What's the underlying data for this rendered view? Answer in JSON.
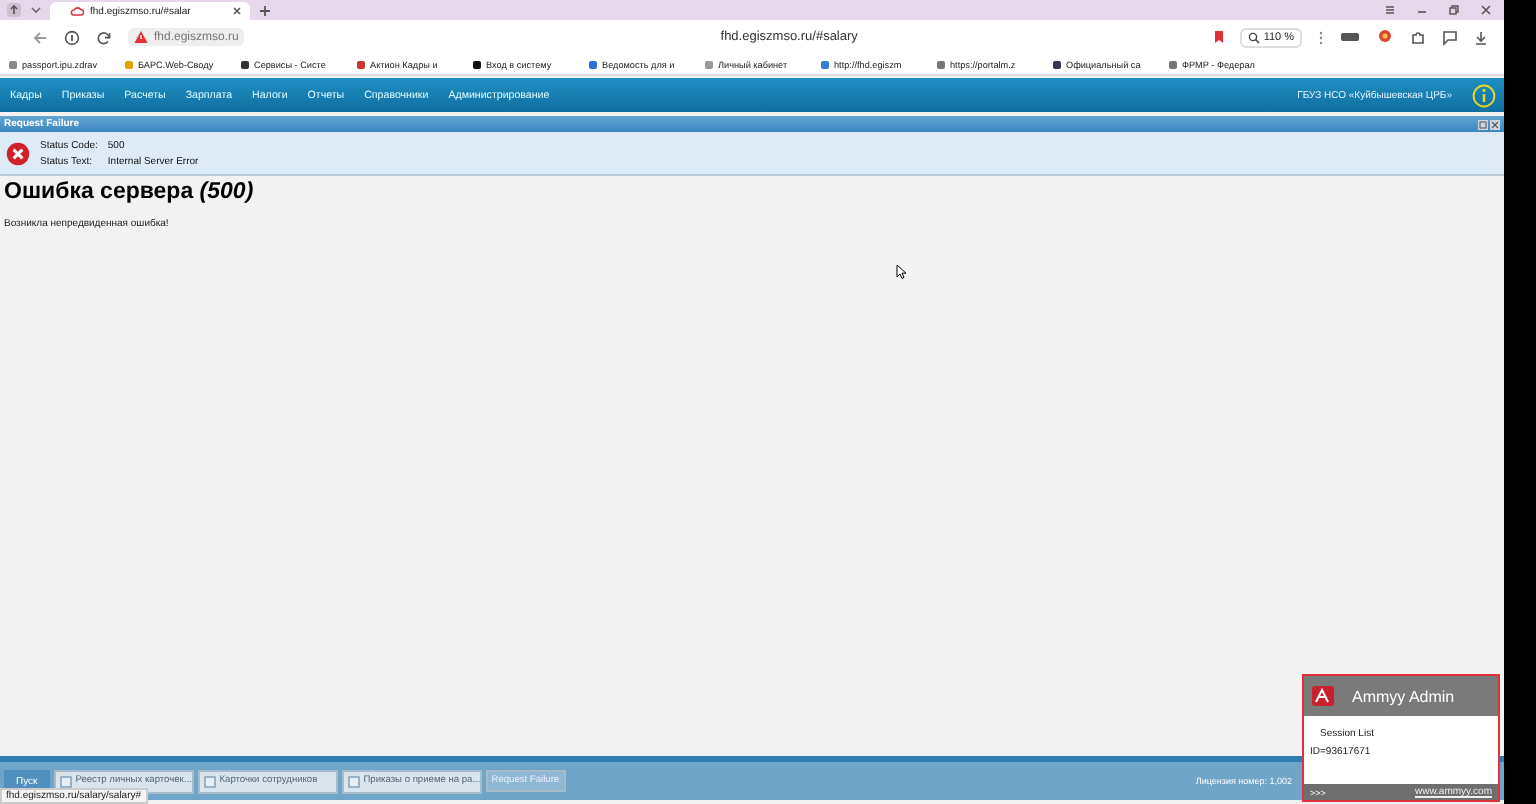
{
  "browser": {
    "tab": {
      "title": "fhd.egiszmso.ru/#salar"
    },
    "address": {
      "site": "fhd.egiszmso.ru",
      "url": "fhd.egiszmso.ru/#salary"
    },
    "zoom": "110 %",
    "bookmarks": [
      {
        "label": "passport.ipu.zdrav"
      },
      {
        "label": "БАРС.Web-Своду"
      },
      {
        "label": "Сервисы - Систе"
      },
      {
        "label": "Актион Кадры и"
      },
      {
        "label": "Вход в систему"
      },
      {
        "label": "Ведомость для и"
      },
      {
        "label": "Личный кабинет"
      },
      {
        "label": "http://fhd.egiszm"
      },
      {
        "label": "https://portalm.z"
      },
      {
        "label": "Официальный са"
      },
      {
        "label": "ФРМР - Федерал"
      }
    ]
  },
  "app": {
    "menu": [
      "Кадры",
      "Приказы",
      "Расчеты",
      "Зарплата",
      "Налоги",
      "Отчеты",
      "Справочники",
      "Администрирование"
    ],
    "organization": "ГБУЗ НСО «Куйбышевская ЦРБ»",
    "panel_title": "Request Failure",
    "status": [
      {
        "label": "Status Code:",
        "value": "500"
      },
      {
        "label": "Status Text:",
        "value": "Internal Server Error"
      }
    ],
    "heading": "Ошибка сервера *(500)*",
    "message": "Возникла непредвиденная ошибка!",
    "taskbar": {
      "start": "Пуск",
      "windows": [
        {
          "title": "Реестр личных карточек...",
          "selected": false
        },
        {
          "title": "Карточки сотрудников",
          "selected": false
        },
        {
          "title": "Приказы о приеме на ра...",
          "selected": false
        },
        {
          "title": "Request Failure",
          "selected": true
        }
      ],
      "license": "Лицензия номер: 1,002"
    }
  },
  "status_url": "fhd.egiszmso.ru/salary/salary#",
  "ammyy": {
    "title": "Ammyy Admin",
    "session_label": "Session List",
    "id": "ID=93617671",
    "footer_left": ">>>",
    "link": "www.ammyy.com"
  }
}
